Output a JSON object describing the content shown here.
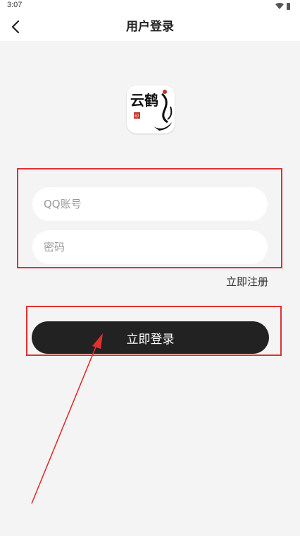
{
  "status_bar": {
    "time": "3:07"
  },
  "nav": {
    "title": "用户登录"
  },
  "logo": {
    "text": "云鹤",
    "seal": "印"
  },
  "form": {
    "qq_placeholder": "QQ账号",
    "password_placeholder": "密码",
    "register_label": "立即注册",
    "login_label": "立即登录"
  },
  "colors": {
    "background": "#f4f4f4",
    "button": "#222222",
    "annotation": "#e03030"
  }
}
